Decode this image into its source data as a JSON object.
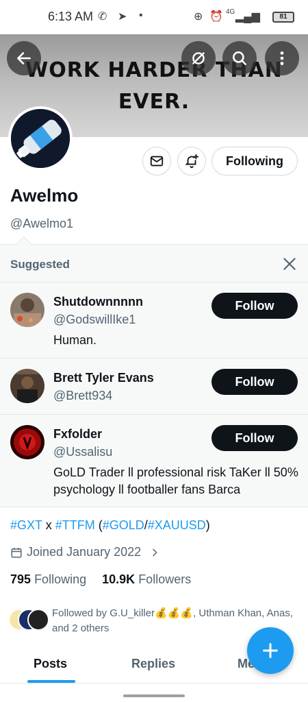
{
  "status_bar": {
    "time": "6:13 AM",
    "battery": "81",
    "network": "4G"
  },
  "banner": {
    "line1": "WORK HARDER THAN",
    "line2": "EVER."
  },
  "profile": {
    "display_name": "Awelmo",
    "handle": "@Awelmo1",
    "following_label": "Following",
    "bio": {
      "tag1": "#GXT",
      "sep1": " x ",
      "tag2": "#TTFM",
      "sep2": " (",
      "tag3": "#GOLD",
      "sep3": "/",
      "tag4": "#XAUUSD",
      "sep4": ")"
    },
    "joined": "Joined January 2022",
    "following_count": "795",
    "following_text": "Following",
    "followers_count": "10.9K",
    "followers_text": "Followers",
    "followed_by": "Followed by G.U_killer💰💰💰, Uthman Khan, Anas, and 2 others"
  },
  "suggested": {
    "title": "Suggested",
    "items": [
      {
        "name": "Shutdownnnnn",
        "handle": "@GodswillIke1",
        "bio": "Human.",
        "button": "Follow"
      },
      {
        "name": "Brett Tyler Evans",
        "handle": "@Brett934",
        "bio": "",
        "button": "Follow"
      },
      {
        "name": "Fxfolder",
        "handle": "@Ussalisu",
        "bio": "GoLD Trader ll professional risk TaKer  ll 50% psychology ll footballer fans Barca",
        "button": "Follow"
      }
    ]
  },
  "tabs": [
    {
      "label": "Posts",
      "active": true
    },
    {
      "label": "Replies",
      "active": false
    },
    {
      "label": "Media",
      "active": false
    }
  ],
  "colors": {
    "accent": "#1d9bf0",
    "text": "#0f1419",
    "muted": "#536471"
  }
}
